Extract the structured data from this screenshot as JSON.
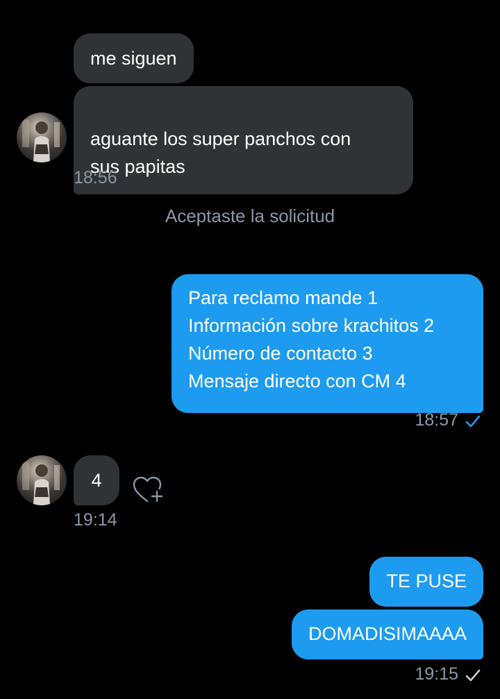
{
  "conversation": {
    "group1": {
      "messages": [
        "me siguen",
        "aguante los super panchos con\nsus papitas"
      ],
      "time": "18:56"
    },
    "system_notice": "Aceptaste la solicitud",
    "group2": {
      "lines": [
        "Para reclamo mande 1",
        "Información sobre krachitos 2",
        "Número de contacto 3",
        "Mensaje directo con CM 4"
      ],
      "time": "18:57",
      "status": "seen",
      "status_color": "#1d9bf0"
    },
    "group3": {
      "message": "4",
      "time": "19:14"
    },
    "group4": {
      "messages": [
        "TE PUSE",
        "DOMADISIMAAAA"
      ],
      "time": "19:15",
      "status": "sent",
      "status_color": "#c9cdd1"
    }
  },
  "colors": {
    "background": "#000000",
    "incoming_bubble": "#2f3336",
    "outgoing_bubble": "#1d9bf0",
    "meta_text": "#8b98a5"
  },
  "icons": {
    "avatar": "profile-photo",
    "react": "heart-plus-icon",
    "seen": "check-icon",
    "sent": "check-icon"
  }
}
